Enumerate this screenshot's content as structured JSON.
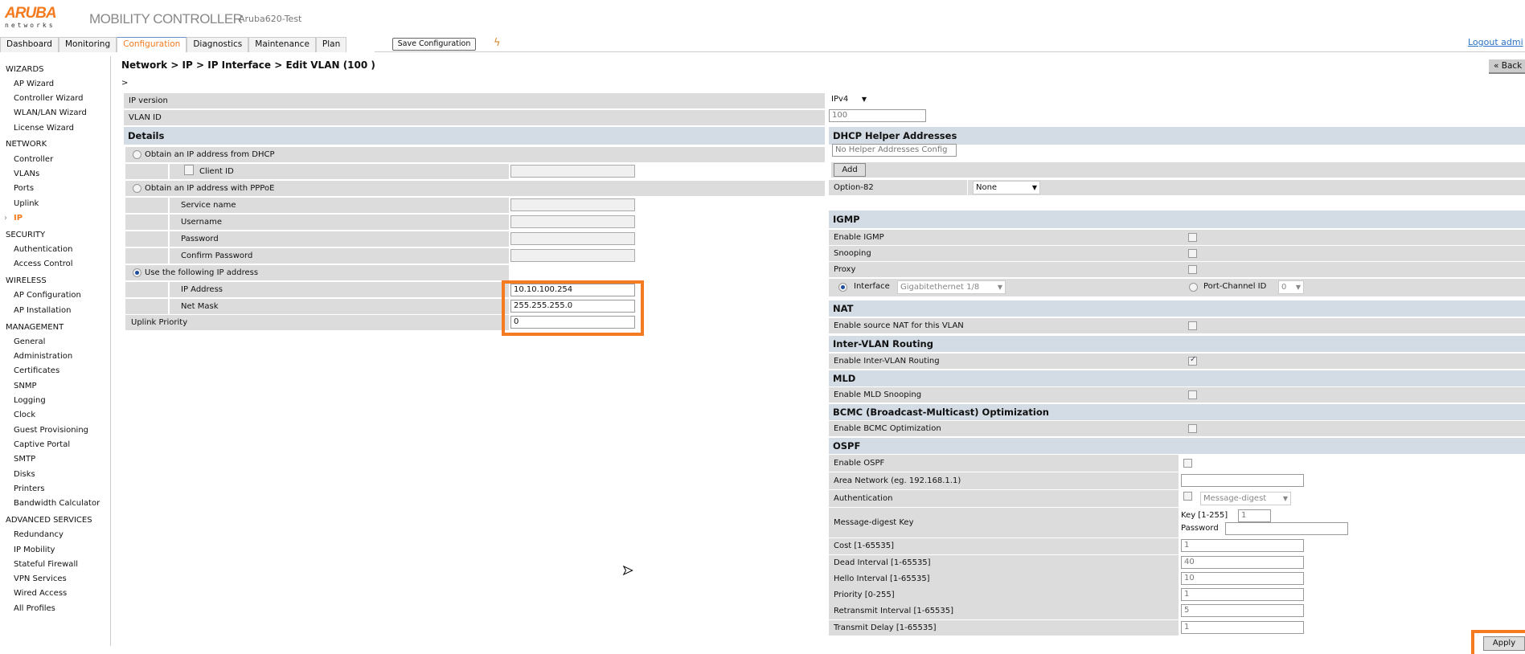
{
  "header": {
    "logo_text": "ARUBA",
    "logo_sub": "networks",
    "product": "MOBILITY CONTROLLER",
    "hostname": "Aruba620-Test",
    "logout": "Logout admi"
  },
  "tabs": [
    "Dashboard",
    "Monitoring",
    "Configuration",
    "Diagnostics",
    "Maintenance",
    "Plan"
  ],
  "active_tab": "Configuration",
  "save_button": "Save Configuration",
  "sidebar": [
    {
      "group": "WIZARDS",
      "items": [
        "AP Wizard",
        "Controller Wizard",
        "WLAN/LAN Wizard",
        "License Wizard"
      ]
    },
    {
      "group": "NETWORK",
      "items": [
        "Controller",
        "VLANs",
        "Ports",
        "Uplink",
        "IP"
      ]
    },
    {
      "group": "SECURITY",
      "items": [
        "Authentication",
        "Access Control"
      ]
    },
    {
      "group": "WIRELESS",
      "items": [
        "AP Configuration",
        "AP Installation"
      ]
    },
    {
      "group": "MANAGEMENT",
      "items": [
        "General",
        "Administration",
        "Certificates",
        "SNMP",
        "Logging",
        "Clock",
        "Guest Provisioning",
        "Captive Portal",
        "SMTP",
        "Disks",
        "Printers",
        "Bandwidth Calculator"
      ]
    },
    {
      "group": "ADVANCED SERVICES",
      "items": [
        "Redundancy",
        "IP Mobility",
        "Stateful Firewall",
        "VPN Services",
        "Wired Access",
        "All Profiles"
      ]
    }
  ],
  "active_sidebar_item": "IP",
  "page": {
    "title": "Network > IP > IP Interface > Edit VLAN (100 )",
    "sub": ">",
    "back": "« Back",
    "apply": "Apply"
  },
  "left": {
    "ip_version_label": "IP version",
    "ip_version": "IPv4",
    "vlan_id_label": "VLAN ID",
    "vlan_id": "100",
    "details": "Details",
    "dhcp_option": "Obtain an IP address from DHCP",
    "client_id": "Client ID",
    "pppoe_option": "Obtain an IP address with PPPoE",
    "service_name": "Service name",
    "username": "Username",
    "password": "Password",
    "confirm_password": "Confirm Password",
    "static_option": "Use the following IP address",
    "ip_address_label": "IP Address",
    "ip_address": "10.10.100.254",
    "net_mask_label": "Net Mask",
    "net_mask": "255.255.255.0",
    "uplink_priority_label": "Uplink Priority",
    "uplink_priority": "0"
  },
  "right": {
    "dhcp_helper": "DHCP Helper Addresses",
    "helper_value": "No Helper Addresses Config",
    "add": "Add",
    "option82_label": "Option-82",
    "option82": "None",
    "igmp": "IGMP",
    "enable_igmp": "Enable IGMP",
    "snooping": "Snooping",
    "proxy": "Proxy",
    "interface_label": "Interface",
    "interface": "Gigabitethernet 1/8",
    "port_channel_label": "Port-Channel ID",
    "port_channel": "0",
    "nat": "NAT",
    "enable_nat": "Enable source NAT for this VLAN",
    "intervlan": "Inter-VLAN Routing",
    "enable_intervlan": "Enable Inter-VLAN Routing",
    "mld": "MLD",
    "enable_mld": "Enable MLD Snooping",
    "bcmc": "BCMC (Broadcast-Multicast) Optimization",
    "enable_bcmc": "Enable BCMC Optimization",
    "ospf": "OSPF",
    "enable_ospf": "Enable OSPF",
    "area_network": "Area Network (eg. 192.168.1.1)",
    "authentication": "Authentication",
    "auth_type": "Message-digest",
    "md_key_label": "Message-digest Key",
    "key_label": "Key [1-255]",
    "key": "1",
    "password_label": "Password",
    "cost_label": "Cost [1-65535]",
    "cost": "1",
    "dead_label": "Dead Interval [1-65535]",
    "dead": "40",
    "hello_label": "Hello Interval [1-65535]",
    "hello": "10",
    "priority_label": "Priority [0-255]",
    "priority": "1",
    "retransmit_label": "Retransmit Interval [1-65535]",
    "retransmit": "5",
    "transmit_label": "Transmit Delay [1-65535]",
    "transmit": "1"
  }
}
